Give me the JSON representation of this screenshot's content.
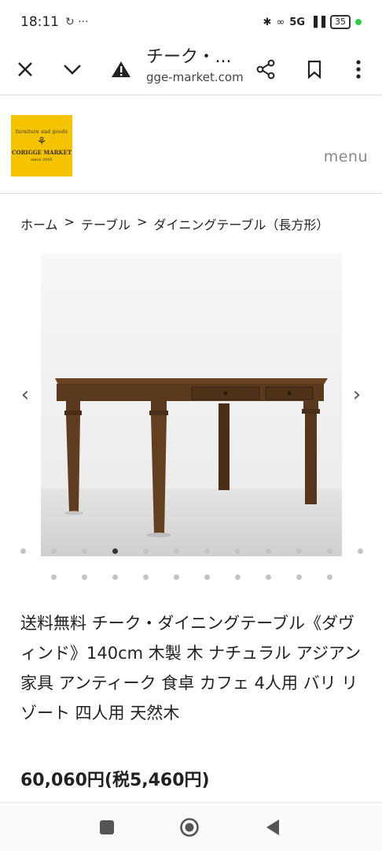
{
  "status": {
    "time": "18:11",
    "extra": "↻ ···",
    "network": "5G",
    "battery": "35"
  },
  "browser": {
    "page_title": "チーク・...",
    "url": "gge-market.com"
  },
  "site": {
    "logo_tagline": "furniture and goods",
    "logo_name": "CORIGGE MARKET",
    "logo_since": "since 2005",
    "menu_label": "menu"
  },
  "breadcrumb": [
    "ホーム",
    "テーブル",
    "ダイニングテーブル（長方形）"
  ],
  "breadcrumb_separator": ">",
  "carousel": {
    "prev": "‹",
    "next": "›",
    "total_images": 12,
    "active_index": 3,
    "second_row_dots": 10
  },
  "product": {
    "title": "送料無料 チーク・ダイニングテーブル《ダヴィンド》140cm 木製 木 ナチュラル アジアン家具 アンティーク 食卓 カフェ 4人用 バリ リゾート 四人用 天然木",
    "price": "60,060円(税5,460円)"
  },
  "colors": {
    "logo_bg": "#f5c400",
    "wood": "#5a3a1e"
  }
}
